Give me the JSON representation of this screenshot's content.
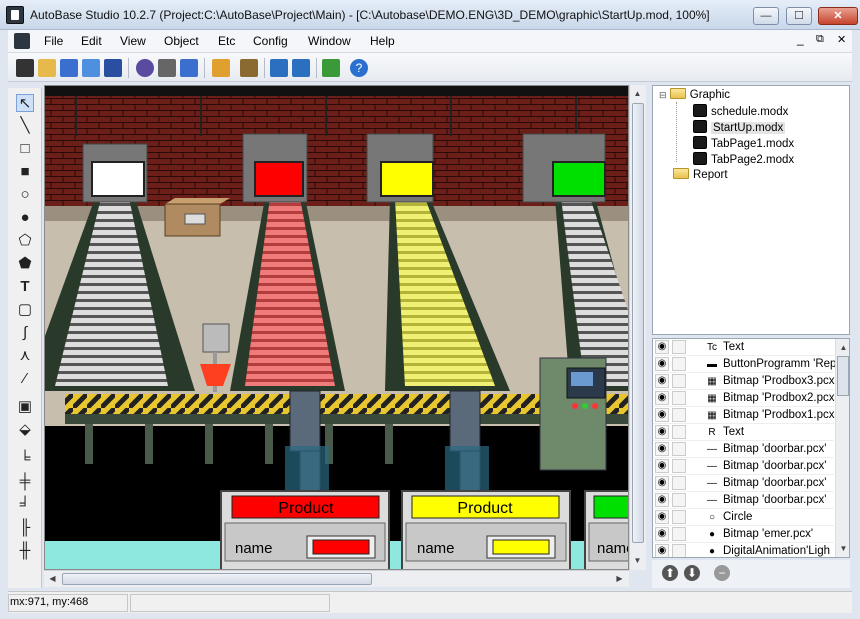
{
  "window": {
    "title": "AutoBase Studio 10.2.7 (Project:C:\\AutoBase\\Project\\Main) - [C:\\Autobase\\DEMO.ENG\\3D_DEMO\\graphic\\StartUp.mod, 100%]",
    "minimize": "—",
    "maximize": "☐",
    "close": "✕"
  },
  "menu": [
    "File",
    "Edit",
    "View",
    "Object",
    "Etc",
    "Config",
    "Window",
    "Help"
  ],
  "mdi_controls": {
    "minimize": "_",
    "restore": "⧉",
    "close": "✕"
  },
  "canvas": {
    "product_labels": [
      "Product",
      "Product"
    ],
    "name_labels": [
      "name",
      "name",
      "name"
    ],
    "door_colors": [
      "#ffffff",
      "#ff0000",
      "#ffff00",
      "#00dd00"
    ]
  },
  "tree": {
    "root": "Graphic",
    "files": [
      "schedule.modx",
      "StartUp.modx",
      "TabPage1.modx",
      "TabPage2.modx"
    ],
    "selected": "StartUp.modx",
    "report": "Report"
  },
  "objects": [
    {
      "icon": "Tc",
      "label": "Text"
    },
    {
      "icon": "▬",
      "label": "ButtonProgramm 'Rep"
    },
    {
      "icon": "▦",
      "label": "Bitmap 'Prodbox3.pcx"
    },
    {
      "icon": "▦",
      "label": "Bitmap 'Prodbox2.pcx"
    },
    {
      "icon": "▦",
      "label": "Bitmap 'Prodbox1.pcx"
    },
    {
      "icon": "R",
      "label": "Text"
    },
    {
      "icon": "—",
      "label": "Bitmap 'doorbar.pcx'"
    },
    {
      "icon": "—",
      "label": "Bitmap 'doorbar.pcx'"
    },
    {
      "icon": "—",
      "label": "Bitmap 'doorbar.pcx'"
    },
    {
      "icon": "—",
      "label": "Bitmap 'doorbar.pcx'"
    },
    {
      "icon": "○",
      "label": "Circle"
    },
    {
      "icon": "●",
      "label": "Bitmap 'emer.pcx'"
    },
    {
      "icon": "●",
      "label": "DigitalAnimation'Ligh"
    }
  ],
  "status": {
    "coords": "mx:971, my:468"
  }
}
